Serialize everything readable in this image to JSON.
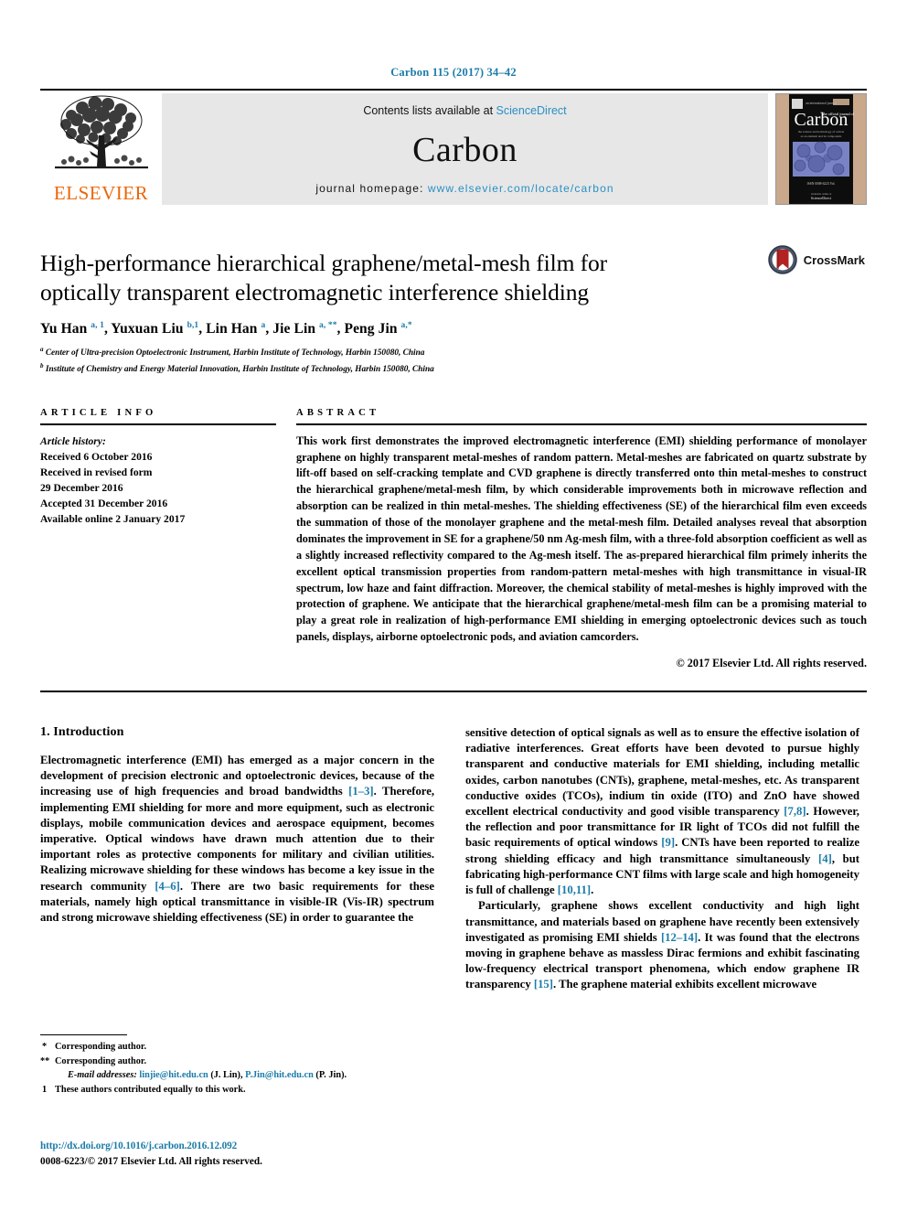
{
  "citation": "Carbon 115 (2017) 34–42",
  "masthead": {
    "contents_prefix": "Contents lists available at ",
    "sciencedirect": "ScienceDirect",
    "journal_name": "Carbon",
    "homepage_prefix": "journal homepage: ",
    "homepage_url": "www.elsevier.com/locate/carbon",
    "publisher": "ELSEVIER",
    "cover_title": "Carbon",
    "publisher_color": "#ec6608",
    "link_color": "#2a8fc4"
  },
  "article": {
    "title": "High-performance hierarchical graphene/metal-mesh film for optically transparent electromagnetic interference shielding",
    "crossmark_label": "CrossMark",
    "authors_html": "Yu Han <sup>a, 1</sup>, Yuxuan Liu <sup>b,1</sup>, Lin Han <sup>a</sup>, Jie Lin <sup>a, **</sup>, Peng Jin <sup>a,*</sup>",
    "affiliations": [
      "Center of Ultra-precision Optoelectronic Instrument, Harbin Institute of Technology, Harbin 150080, China",
      "Institute of Chemistry and Energy Material Innovation, Harbin Institute of Technology, Harbin 150080, China"
    ],
    "affiliation_marks": [
      "a",
      "b"
    ]
  },
  "info": {
    "heading": "ARTICLE INFO",
    "history_label": "Article history:",
    "history": [
      "Received 6 October 2016",
      "Received in revised form",
      "29 December 2016",
      "Accepted 31 December 2016",
      "Available online 2 January 2017"
    ]
  },
  "abstract": {
    "heading": "ABSTRACT",
    "text": "This work first demonstrates the improved electromagnetic interference (EMI) shielding performance of monolayer graphene on highly transparent metal-meshes of random pattern. Metal-meshes are fabricated on quartz substrate by lift-off based on self-cracking template and CVD graphene is directly transferred onto thin metal-meshes to construct the hierarchical graphene/metal-mesh film, by which considerable improvements both in microwave reflection and absorption can be realized in thin metal-meshes. The shielding effectiveness (SE) of the hierarchical film even exceeds the summation of those of the monolayer graphene and the metal-mesh film. Detailed analyses reveal that absorption dominates the improvement in SE for a graphene/50 nm Ag-mesh film, with a three-fold absorption coefficient as well as a slightly increased reflectivity compared to the Ag-mesh itself. The as-prepared hierarchical film primely inherits the excellent optical transmission properties from random-pattern metal-meshes with high transmittance in visual-IR spectrum, low haze and faint diffraction. Moreover, the chemical stability of metal-meshes is highly improved with the protection of graphene. We anticipate that the hierarchical graphene/metal-mesh film can be a promising material to play a great role in realization of high-performance EMI shielding in emerging optoelectronic devices such as touch panels, displays, airborne optoelectronic pods, and aviation camcorders.",
    "copyright": "© 2017 Elsevier Ltd. All rights reserved."
  },
  "body": {
    "section_number_title": "1. Introduction",
    "left_paragraphs": [
      "Electromagnetic interference (EMI) has emerged as a major concern in the development of precision electronic and optoelectronic devices, because of the increasing use of high frequencies and broad bandwidths [1–3]. Therefore, implementing EMI shielding for more and more equipment, such as electronic displays, mobile communication devices and aerospace equipment, becomes imperative. Optical windows have drawn much attention due to their important roles as protective components for military and civilian utilities. Realizing microwave shielding for these windows has become a key issue in the research community [4–6]. There are two basic requirements for these materials, namely high optical transmittance in visible-IR (Vis-IR) spectrum and strong microwave shielding effectiveness (SE) in order to guarantee the"
    ],
    "right_paragraphs": [
      "sensitive detection of optical signals as well as to ensure the effective isolation of radiative interferences. Great efforts have been devoted to pursue highly transparent and conductive materials for EMI shielding, including metallic oxides, carbon nanotubes (CNTs), graphene, metal-meshes, etc. As transparent conductive oxides (TCOs), indium tin oxide (ITO) and ZnO have showed excellent electrical conductivity and good visible transparency [7,8]. However, the reflection and poor transmittance for IR light of TCOs did not fulfill the basic requirements of optical windows [9]. CNTs have been reported to realize strong shielding efficacy and high transmittance simultaneously [4], but fabricating high-performance CNT films with large scale and high homogeneity is full of challenge [10,11].",
      "Particularly, graphene shows excellent conductivity and high light transmittance, and materials based on graphene have recently been extensively investigated as promising EMI shields [12–14]. It was found that the electrons moving in graphene behave as massless Dirac fermions and exhibit fascinating low-frequency electrical transport phenomena, which endow graphene IR transparency [15]. The graphene material exhibits excellent microwave"
    ],
    "citation_refs_left": [
      "[1–3]",
      "[4–6]"
    ],
    "citation_refs_right": [
      "[7,8]",
      "[9]",
      "[4]",
      "[10,11]",
      "[12–14]",
      "[15]"
    ]
  },
  "footnotes": {
    "corresponding_1": "Corresponding author.",
    "corresponding_2": "Corresponding author.",
    "email_label": "E-mail addresses:",
    "email_1": "linjie@hit.edu.cn",
    "email_1_owner": "(J. Lin)",
    "email_2": "P.Jin@hit.edu.cn",
    "email_2_owner": "(P. Jin).",
    "equal_contrib": "These authors contributed equally to this work.",
    "mark_1": "*",
    "mark_2": "**",
    "mark_3": "1"
  },
  "footer": {
    "doi": "http://dx.doi.org/10.1016/j.carbon.2016.12.092",
    "issn_line": "0008-6223/© 2017 Elsevier Ltd. All rights reserved."
  }
}
